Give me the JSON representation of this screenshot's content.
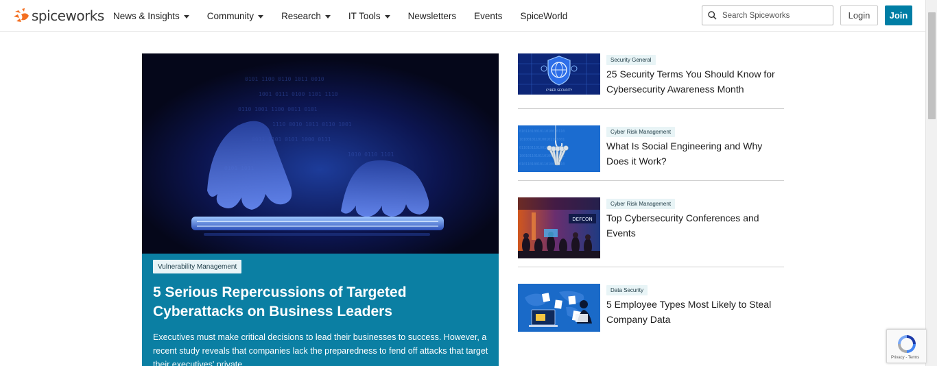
{
  "header": {
    "logo_text": "spiceworks",
    "nav": [
      {
        "label": "News & Insights",
        "dropdown": true
      },
      {
        "label": "Community",
        "dropdown": true
      },
      {
        "label": "Research",
        "dropdown": true
      },
      {
        "label": "IT Tools",
        "dropdown": true
      },
      {
        "label": "Newsletters",
        "dropdown": false
      },
      {
        "label": "Events",
        "dropdown": false
      },
      {
        "label": "SpiceWorld",
        "dropdown": false
      }
    ],
    "search_placeholder": "Search Spiceworks",
    "login_label": "Login",
    "join_label": "Join"
  },
  "colors": {
    "brand_orange": "#f36f21",
    "accent_blue": "#007ea5",
    "hero_bg": "#0b7fa3"
  },
  "hero": {
    "image_icon": "hands-typing-keyboard-image",
    "tag": "Vulnerability Management",
    "title": "5 Serious Repercussions of Targeted Cyberattacks on Business Leaders",
    "description": "Executives must make critical decisions to lead their businesses to success. However, a recent study reveals that companies lack the preparedness to fend off attacks that target their executives' private ..."
  },
  "articles": [
    {
      "tag": "Security General",
      "title": "25 Security Terms You Should Know for Cybersecurity Awareness Month",
      "thumb_icon": "globe-shield-icon",
      "thumb_text": "CYBER SECURITY"
    },
    {
      "tag": "Cyber Risk Management",
      "title": "What Is Social Engineering and Why Does it Work?",
      "thumb_icon": "fishing-hook-keys-icon"
    },
    {
      "tag": "Cyber Risk Management",
      "title": "Top Cybersecurity Conferences and Events",
      "thumb_icon": "conference-crowd-image",
      "thumb_text": "DEFCON"
    },
    {
      "tag": "Data Security",
      "title": "5 Employee Types Most Likely to Steal Company Data",
      "thumb_icon": "hacker-laptop-documents-icon"
    }
  ],
  "recaptcha": {
    "text": "Privacy - Terms"
  }
}
